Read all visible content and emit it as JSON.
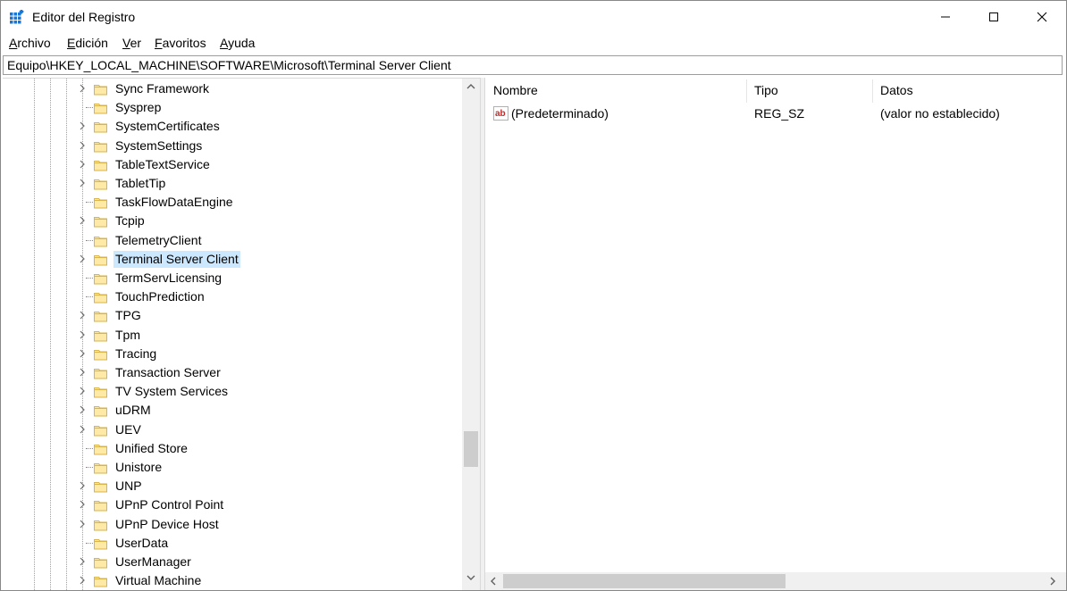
{
  "window": {
    "title": "Editor del Registro"
  },
  "menu": [
    {
      "underline": "A",
      "rest": "rchivo"
    },
    {
      "underline": "E",
      "rest": "dición"
    },
    {
      "underline": "V",
      "rest": "er"
    },
    {
      "underline": "F",
      "rest": "avoritos"
    },
    {
      "underline": "A",
      "rest": "yuda"
    }
  ],
  "address": {
    "path": "Equipo\\HKEY_LOCAL_MACHINE\\SOFTWARE\\Microsoft\\Terminal Server Client"
  },
  "tree": {
    "items": [
      {
        "label": "Sync Framework",
        "expandable": true,
        "selected": false
      },
      {
        "label": "Sysprep",
        "expandable": false,
        "selected": false
      },
      {
        "label": "SystemCertificates",
        "expandable": true,
        "selected": false
      },
      {
        "label": "SystemSettings",
        "expandable": true,
        "selected": false
      },
      {
        "label": "TableTextService",
        "expandable": true,
        "selected": false
      },
      {
        "label": "TabletTip",
        "expandable": true,
        "selected": false
      },
      {
        "label": "TaskFlowDataEngine",
        "expandable": false,
        "selected": false
      },
      {
        "label": "Tcpip",
        "expandable": true,
        "selected": false
      },
      {
        "label": "TelemetryClient",
        "expandable": false,
        "selected": false
      },
      {
        "label": "Terminal Server Client",
        "expandable": true,
        "selected": true
      },
      {
        "label": "TermServLicensing",
        "expandable": false,
        "selected": false
      },
      {
        "label": "TouchPrediction",
        "expandable": false,
        "selected": false
      },
      {
        "label": "TPG",
        "expandable": true,
        "selected": false
      },
      {
        "label": "Tpm",
        "expandable": true,
        "selected": false
      },
      {
        "label": "Tracing",
        "expandable": true,
        "selected": false
      },
      {
        "label": "Transaction Server",
        "expandable": true,
        "selected": false
      },
      {
        "label": "TV System Services",
        "expandable": true,
        "selected": false
      },
      {
        "label": "uDRM",
        "expandable": true,
        "selected": false
      },
      {
        "label": "UEV",
        "expandable": true,
        "selected": false
      },
      {
        "label": "Unified Store",
        "expandable": false,
        "selected": false
      },
      {
        "label": "Unistore",
        "expandable": false,
        "selected": false
      },
      {
        "label": "UNP",
        "expandable": true,
        "selected": false
      },
      {
        "label": "UPnP Control Point",
        "expandable": true,
        "selected": false
      },
      {
        "label": "UPnP Device Host",
        "expandable": true,
        "selected": false
      },
      {
        "label": "UserData",
        "expandable": false,
        "selected": false
      },
      {
        "label": "UserManager",
        "expandable": true,
        "selected": false
      },
      {
        "label": "Virtual Machine",
        "expandable": true,
        "selected": false
      }
    ]
  },
  "list": {
    "columns": {
      "name": "Nombre",
      "type": "Tipo",
      "data": "Datos"
    },
    "rows": [
      {
        "name": "(Predeterminado)",
        "type": "REG_SZ",
        "data": "(valor no establecido)"
      }
    ]
  },
  "colors": {
    "selection": "#cce8ff",
    "folder": "#ffe9a6",
    "folder_border": "#d9b44a",
    "icon_blue": "#1976d2"
  },
  "icons": {
    "app": "registry-editor-icon",
    "tree_item": "folder-icon",
    "value": "string-value-icon"
  }
}
